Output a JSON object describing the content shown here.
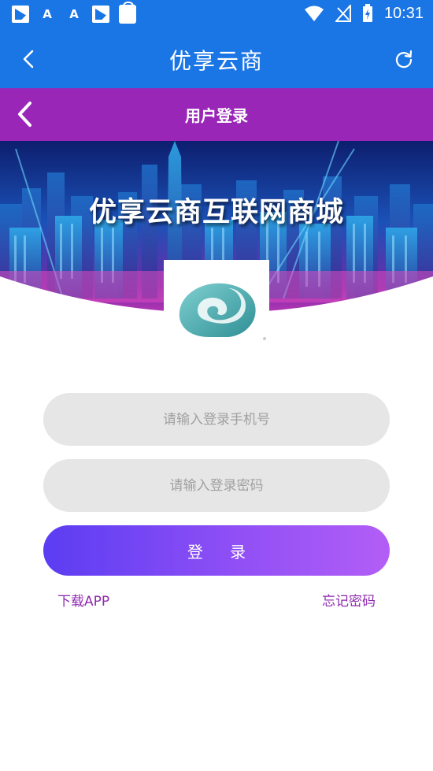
{
  "status_bar": {
    "time": "10:31",
    "left_icons": [
      "image-icon",
      "a-logo-icon",
      "a-logo-icon",
      "image-icon",
      "shopping-bag-icon"
    ],
    "right_icons": [
      "wifi-icon",
      "no-signal-icon",
      "battery-charging-icon"
    ]
  },
  "app_bar": {
    "title": "优享云商",
    "back_icon": "chevron-left-icon",
    "refresh_icon": "refresh-icon"
  },
  "page_header": {
    "title": "用户登录",
    "back_icon": "chevron-left-icon"
  },
  "banner": {
    "title": "优享云商互联网商城"
  },
  "logo": {
    "icon": "cloud-logo-icon"
  },
  "form": {
    "phone_placeholder": "请输入登录手机号",
    "password_placeholder": "请输入登录密码",
    "login_label": "登 录"
  },
  "links": {
    "download": "下载APP",
    "forgot": "忘记密码"
  },
  "colors": {
    "status_bar": "#1b76e5",
    "header_purple": "#9a26b8",
    "input_bg": "#e6e6e6",
    "button_gradient_start": "#5b3df2",
    "button_gradient_end": "#b35ef6",
    "link": "#8e2bb0"
  }
}
